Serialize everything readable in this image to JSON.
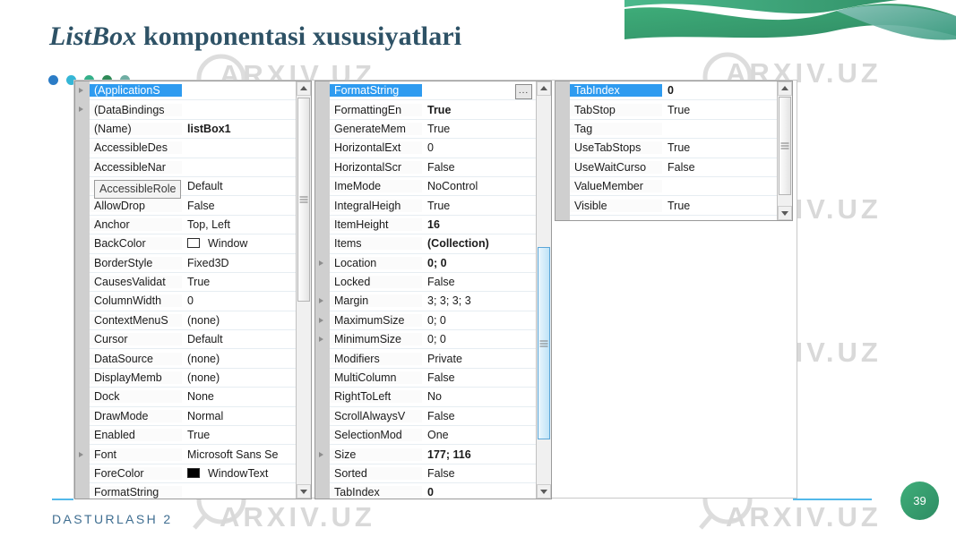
{
  "slide": {
    "title_italic": "ListBox",
    "title_rest": " komponentasi xususiyatlari",
    "footer": "DASTURLASH 2",
    "page_number": "39",
    "accent_blue": "#53b9ea",
    "title_color": "#2e5266",
    "select_blue": "#2e9bf0"
  },
  "dots": [
    {
      "name": "dot-blue",
      "color": "#2b7cc6"
    },
    {
      "name": "dot-cyan",
      "color": "#35b6d6"
    },
    {
      "name": "dot-teal",
      "color": "#34b08a"
    },
    {
      "name": "dot-green",
      "color": "#2f8a57"
    },
    {
      "name": "dot-sage",
      "color": "#6fada3"
    }
  ],
  "watermarks": [
    {
      "text": "ARXIV.UZ"
    },
    {
      "text": "ARXIV.UZ"
    },
    {
      "text": "ARXIV.UZ"
    },
    {
      "text": "ARXIV.UZ"
    },
    {
      "text": "ARXIV.UZ"
    },
    {
      "text": "ARXIV.UZ"
    }
  ],
  "tooltip": {
    "text": "AccessibleRole"
  },
  "panel_left": {
    "rows": [
      {
        "name": "(ApplicationS",
        "value": "",
        "selected": true,
        "expand": true,
        "bold": false
      },
      {
        "name": "(DataBindings",
        "value": "",
        "selected": false,
        "expand": true,
        "bold": false
      },
      {
        "name": "(Name)",
        "value": "listBox1",
        "selected": false,
        "expand": false,
        "bold": true
      },
      {
        "name": "AccessibleDes",
        "value": "",
        "selected": false,
        "expand": false,
        "bold": false
      },
      {
        "name": "AccessibleNar",
        "value": "",
        "selected": false,
        "expand": false,
        "bold": false
      },
      {
        "name": "AccessibleRole",
        "value": "Default",
        "selected": false,
        "expand": false,
        "bold": false
      },
      {
        "name": "AllowDrop",
        "value": "False",
        "selected": false,
        "expand": false,
        "bold": false
      },
      {
        "name": "Anchor",
        "value": "Top, Left",
        "selected": false,
        "expand": false,
        "bold": false
      },
      {
        "name": "BackColor",
        "value": "Window",
        "selected": false,
        "expand": false,
        "bold": false,
        "swatch": "#ffffff"
      },
      {
        "name": "BorderStyle",
        "value": "Fixed3D",
        "selected": false,
        "expand": false,
        "bold": false
      },
      {
        "name": "CausesValidat",
        "value": "True",
        "selected": false,
        "expand": false,
        "bold": false
      },
      {
        "name": "ColumnWidth",
        "value": "0",
        "selected": false,
        "expand": false,
        "bold": false
      },
      {
        "name": "ContextMenuS",
        "value": "(none)",
        "selected": false,
        "expand": false,
        "bold": false
      },
      {
        "name": "Cursor",
        "value": "Default",
        "selected": false,
        "expand": false,
        "bold": false
      },
      {
        "name": "DataSource",
        "value": "(none)",
        "selected": false,
        "expand": false,
        "bold": false
      },
      {
        "name": "DisplayMemb",
        "value": "(none)",
        "selected": false,
        "expand": false,
        "bold": false
      },
      {
        "name": "Dock",
        "value": "None",
        "selected": false,
        "expand": false,
        "bold": false
      },
      {
        "name": "DrawMode",
        "value": "Normal",
        "selected": false,
        "expand": false,
        "bold": false
      },
      {
        "name": "Enabled",
        "value": "True",
        "selected": false,
        "expand": false,
        "bold": false
      },
      {
        "name": "Font",
        "value": "Microsoft Sans Se",
        "selected": false,
        "expand": true,
        "bold": false
      },
      {
        "name": "ForeColor",
        "value": "WindowText",
        "selected": false,
        "expand": false,
        "bold": false,
        "swatch": "#000000"
      },
      {
        "name": "FormatString",
        "value": "",
        "selected": false,
        "expand": false,
        "bold": false
      }
    ]
  },
  "panel_mid": {
    "ellipsis_label": "...",
    "rows": [
      {
        "name": "FormatString",
        "value": "",
        "selected": true,
        "expand": false,
        "bold": false
      },
      {
        "name": "FormattingEn",
        "value": "True",
        "selected": false,
        "expand": false,
        "bold": true
      },
      {
        "name": "GenerateMem",
        "value": "True",
        "selected": false,
        "expand": false,
        "bold": false
      },
      {
        "name": "HorizontalExt",
        "value": "0",
        "selected": false,
        "expand": false,
        "bold": false
      },
      {
        "name": "HorizontalScr",
        "value": "False",
        "selected": false,
        "expand": false,
        "bold": false
      },
      {
        "name": "ImeMode",
        "value": "NoControl",
        "selected": false,
        "expand": false,
        "bold": false
      },
      {
        "name": "IntegralHeigh",
        "value": "True",
        "selected": false,
        "expand": false,
        "bold": false
      },
      {
        "name": "ItemHeight",
        "value": "16",
        "selected": false,
        "expand": false,
        "bold": true
      },
      {
        "name": "Items",
        "value": "(Collection)",
        "selected": false,
        "expand": false,
        "bold": true
      },
      {
        "name": "Location",
        "value": "0; 0",
        "selected": false,
        "expand": true,
        "bold": true
      },
      {
        "name": "Locked",
        "value": "False",
        "selected": false,
        "expand": false,
        "bold": false
      },
      {
        "name": "Margin",
        "value": "3; 3; 3; 3",
        "selected": false,
        "expand": true,
        "bold": false
      },
      {
        "name": "MaximumSize",
        "value": "0; 0",
        "selected": false,
        "expand": true,
        "bold": false
      },
      {
        "name": "MinimumSize",
        "value": "0; 0",
        "selected": false,
        "expand": true,
        "bold": false
      },
      {
        "name": "Modifiers",
        "value": "Private",
        "selected": false,
        "expand": false,
        "bold": false
      },
      {
        "name": "MultiColumn",
        "value": "False",
        "selected": false,
        "expand": false,
        "bold": false
      },
      {
        "name": "RightToLeft",
        "value": "No",
        "selected": false,
        "expand": false,
        "bold": false
      },
      {
        "name": "ScrollAlwaysV",
        "value": "False",
        "selected": false,
        "expand": false,
        "bold": false
      },
      {
        "name": "SelectionMod",
        "value": "One",
        "selected": false,
        "expand": false,
        "bold": false
      },
      {
        "name": "Size",
        "value": "177; 116",
        "selected": false,
        "expand": true,
        "bold": true
      },
      {
        "name": "Sorted",
        "value": "False",
        "selected": false,
        "expand": false,
        "bold": false
      },
      {
        "name": "TabIndex",
        "value": "0",
        "selected": false,
        "expand": false,
        "bold": true
      }
    ]
  },
  "panel_right": {
    "rows": [
      {
        "name": "TabIndex",
        "value": "0",
        "selected": true,
        "expand": false,
        "bold": true
      },
      {
        "name": "TabStop",
        "value": "True",
        "selected": false,
        "expand": false,
        "bold": false
      },
      {
        "name": "Tag",
        "value": "",
        "selected": false,
        "expand": false,
        "bold": false
      },
      {
        "name": "UseTabStops",
        "value": "True",
        "selected": false,
        "expand": false,
        "bold": false
      },
      {
        "name": "UseWaitCurso",
        "value": "False",
        "selected": false,
        "expand": false,
        "bold": false
      },
      {
        "name": "ValueMember",
        "value": "",
        "selected": false,
        "expand": false,
        "bold": false
      },
      {
        "name": "Visible",
        "value": "True",
        "selected": false,
        "expand": false,
        "bold": false
      }
    ]
  }
}
